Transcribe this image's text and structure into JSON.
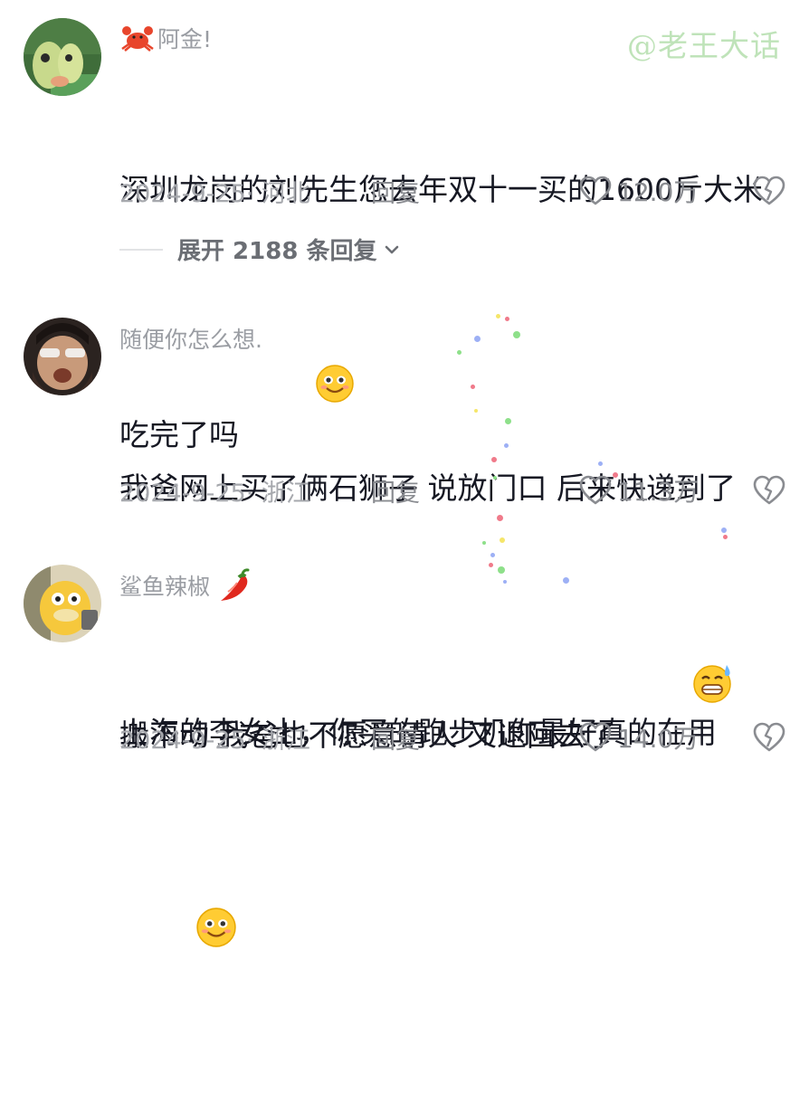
{
  "watermark": "@老王大话",
  "comments": [
    {
      "username": "阿金!",
      "username_emoji": "crab-icon",
      "text_line1": "深圳龙岗的刘先生您去年双十一买的1600斤大米",
      "text_line2": "吃完了吗",
      "text_emoji": "smile-emoji",
      "date_location": "2024-9-25· 河北",
      "reply_label": "回复",
      "like_count": "12.0万",
      "expand_replies": "展开 2188 条回复"
    },
    {
      "username": "随便你怎么想.",
      "text_line1": "我爸网上买了俩石狮子 说放门口 后来快递到了",
      "text_line2": "搬不动 我爸也不愿意请人 又退回去了",
      "text_emoji": "sweat-grin-emoji",
      "date_location": "2024-9-25· 浙江",
      "reply_label": "回复",
      "like_count": "11.3万"
    },
    {
      "username": "鲨鱼辣椒",
      "username_emoji": "chili-pepper-icon",
      "text_line1": "上海的李女士，你买的跑步机你最好真的在用",
      "text_emoji": "smile-emoji",
      "date_location": "2024-9-25· 浙江",
      "reply_label": "回复",
      "like_count": "14.0万"
    }
  ]
}
